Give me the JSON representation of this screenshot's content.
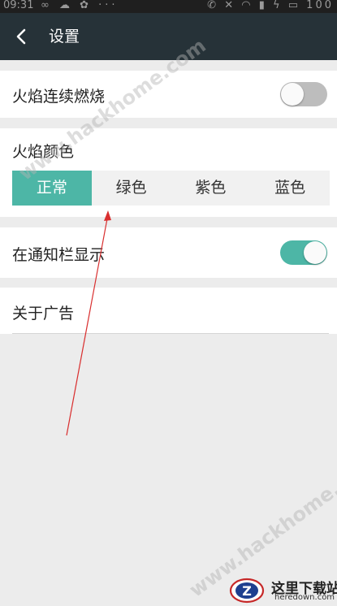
{
  "status_bar": {
    "time": "09:31",
    "left_icons": [
      "infinity-icon",
      "cloud-icon",
      "paw-icon",
      "more-icon"
    ],
    "right_icons": [
      "phone-icon",
      "mute-icon",
      "wifi-icon",
      "signal-icon",
      "charging-icon",
      "battery-icon"
    ],
    "battery_text": "100"
  },
  "toolbar": {
    "back_icon": "chevron-left-icon",
    "title": "设置"
  },
  "settings": {
    "flame_continuous_label": "火焰连续燃烧",
    "flame_continuous_on": false,
    "flame_color_label": "火焰颜色",
    "flame_colors": [
      "正常",
      "绿色",
      "紫色",
      "蓝色"
    ],
    "flame_color_selected": "正常",
    "notification_label": "在通知栏显示",
    "notification_on": true,
    "about_ads_label": "关于广告"
  },
  "colors": {
    "accent": "#4db6a6",
    "toolbar": "#263238",
    "background": "#ececec",
    "arrow": "#d93030"
  },
  "watermark": {
    "text": "www.hackhome.com",
    "logo_title": "这里下载站",
    "logo_sub": "heredown.com",
    "logo_letter": "Z"
  }
}
